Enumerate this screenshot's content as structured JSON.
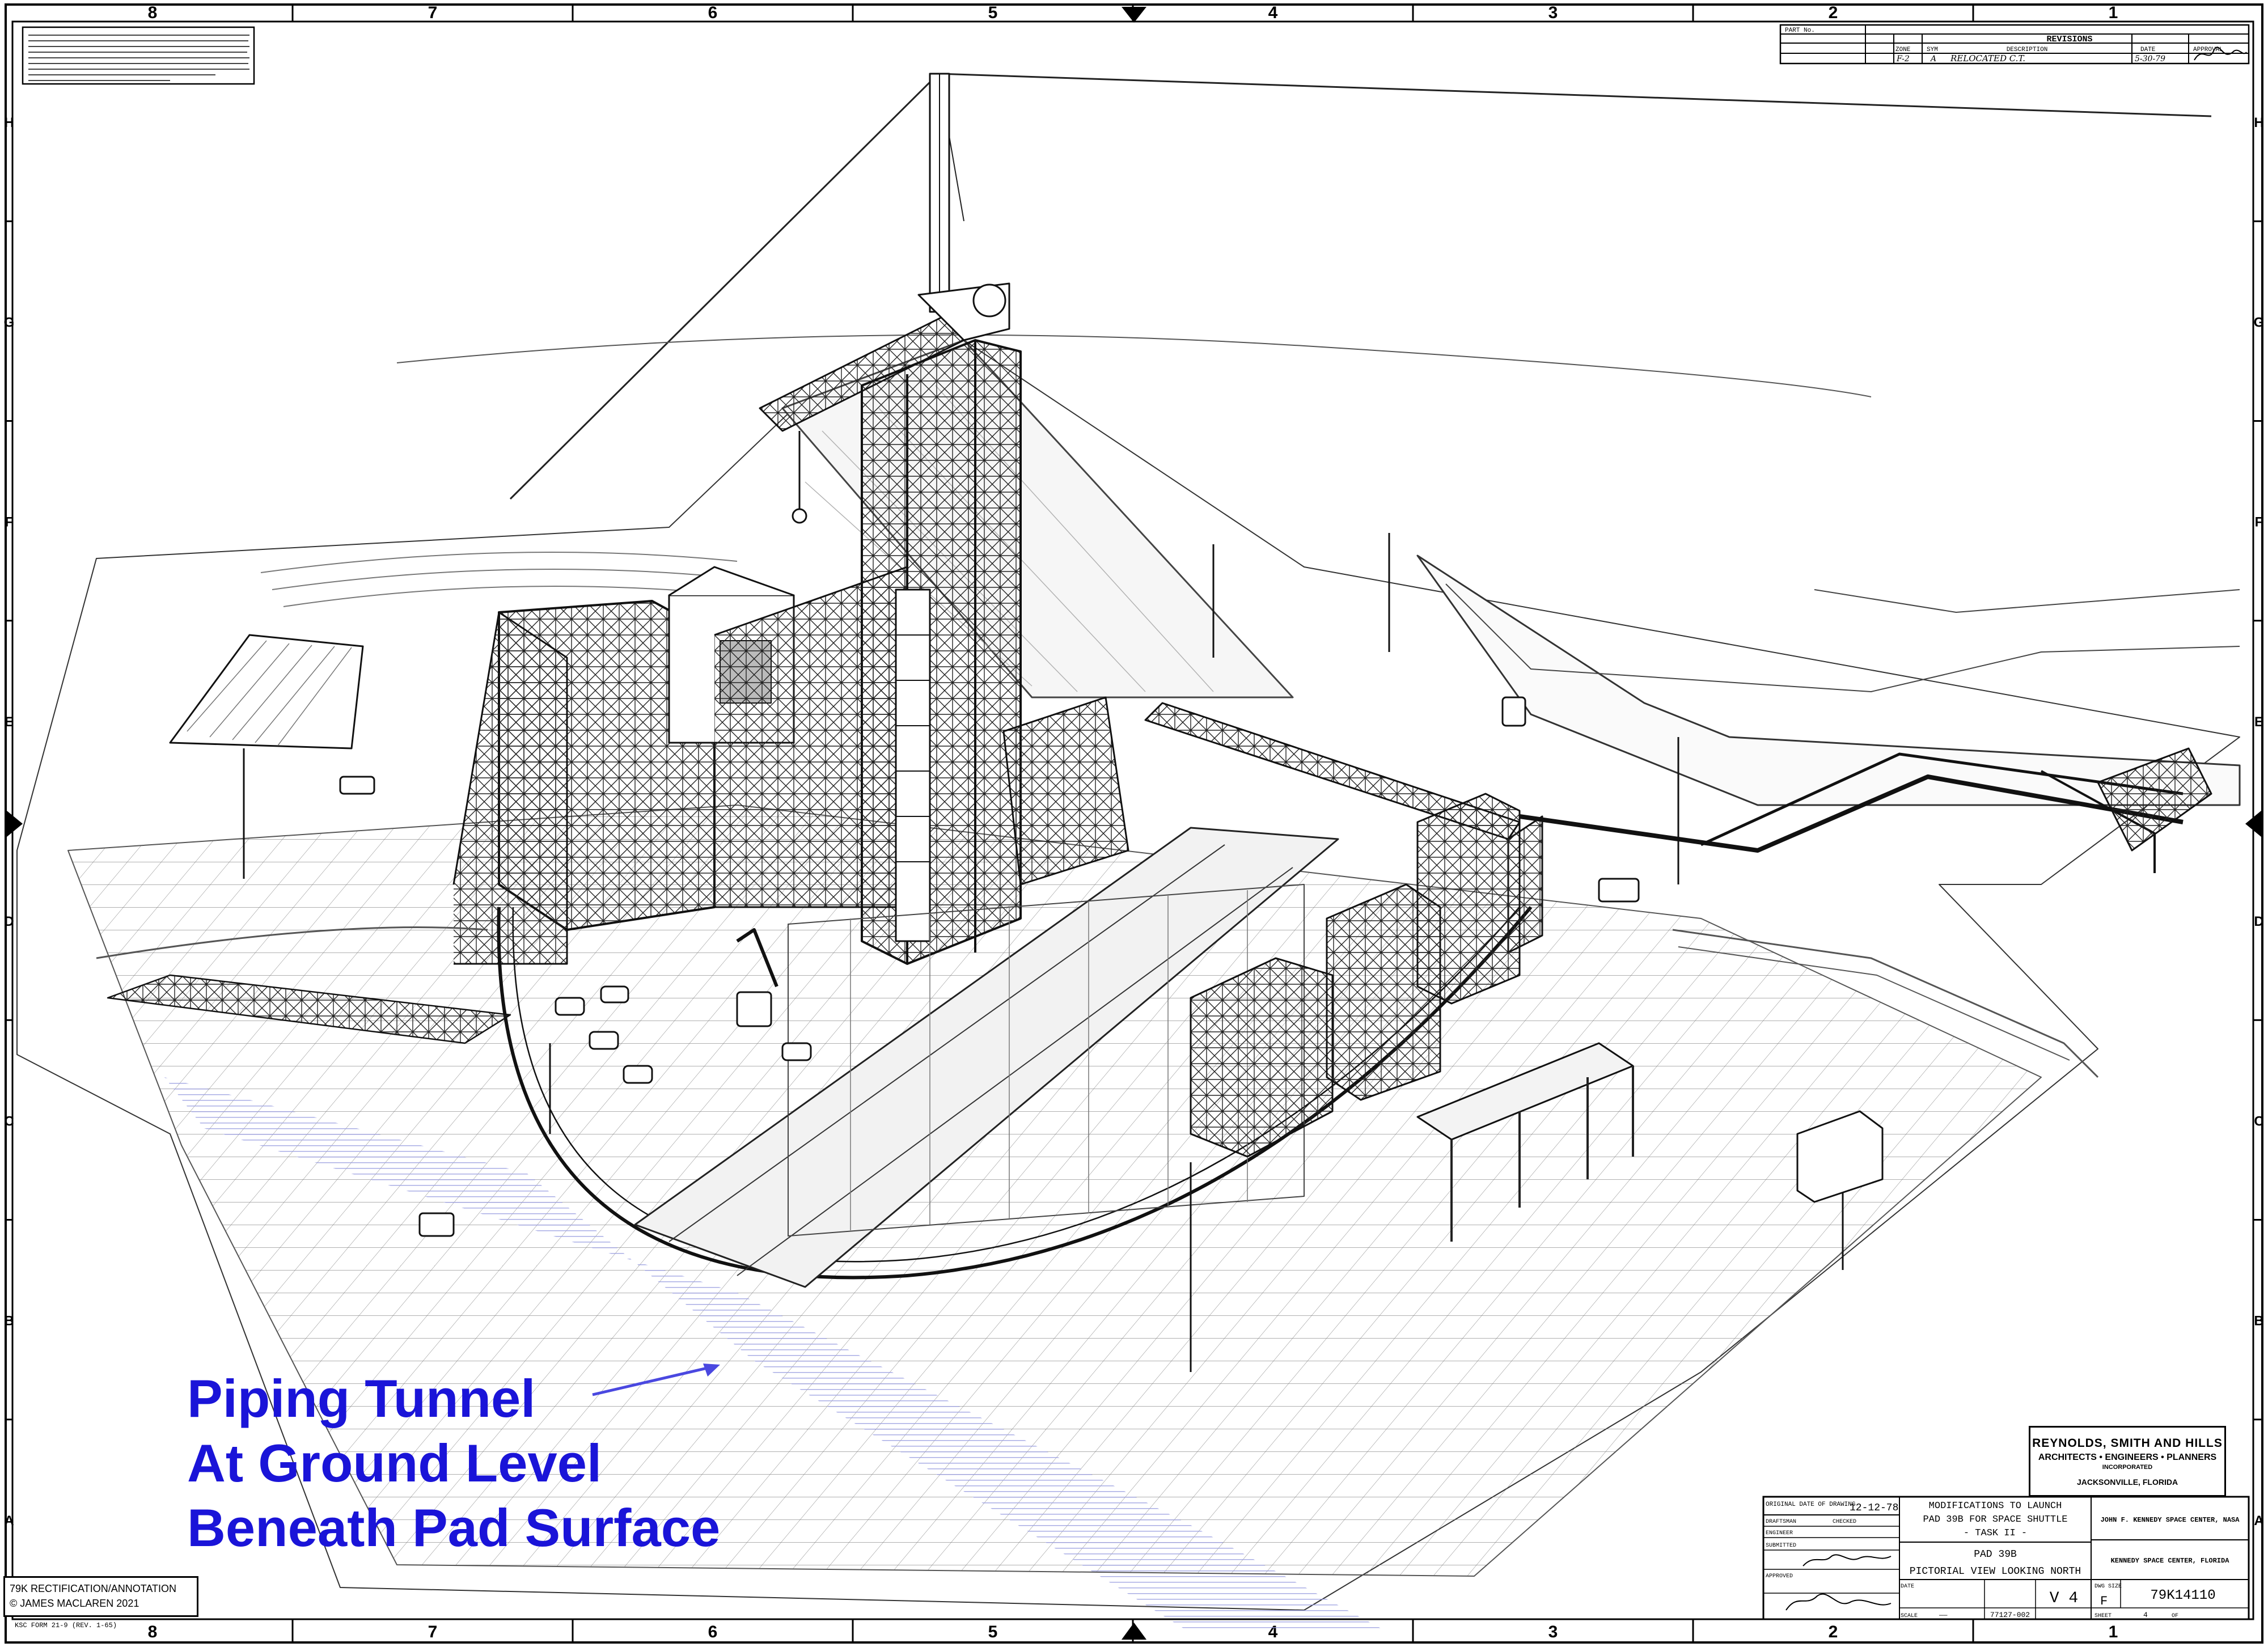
{
  "border": {
    "columns": [
      "8",
      "7",
      "6",
      "5",
      "4",
      "3",
      "2",
      "1"
    ],
    "rows": [
      "H",
      "G",
      "F",
      "E",
      "D",
      "C",
      "B",
      "A"
    ]
  },
  "annotation": {
    "lines": [
      "Piping Tunnel",
      "At Ground Level",
      "Beneath Pad Surface"
    ],
    "color": "#1a14d8"
  },
  "credit": {
    "line1": "79K RECTIFICATION/ANNOTATION",
    "line2": "© JAMES MACLAREN 2021"
  },
  "form_number": "KSC FORM 21-9 (REV. 1-65)",
  "revisions": {
    "part_no_label": "PART No.",
    "title": "REVISIONS",
    "headers": [
      "ZONE",
      "SYM",
      "DESCRIPTION",
      "DATE",
      "APPROVAL"
    ],
    "row": {
      "zone": "F-2",
      "sym": "A",
      "description": "RELOCATED C.T.",
      "date": "5-30-79"
    }
  },
  "firm": {
    "name": "REYNOLDS, SMITH AND HILLS",
    "line2": "ARCHITECTS • ENGINEERS • PLANNERS",
    "line3": "INCORPORATED",
    "city": "JACKSONVILLE, FLORIDA"
  },
  "title_block": {
    "original_date_label": "ORIGINAL DATE OF DRAWING",
    "original_date": "12-12-78",
    "draftsman_label": "DRAFTSMAN",
    "checked_label": "CHECKED",
    "engineer_label": "ENGINEER",
    "submitted_label": "SUBMITTED",
    "approved_label": "APPROVED",
    "date_label": "DATE",
    "title_1": "MODIFICATIONS TO LAUNCH",
    "title_2": "PAD 39B FOR SPACE SHUTTLE",
    "title_3": "- TASK II -",
    "pad": "PAD 39B",
    "view": "PICTORIAL VIEW LOOKING NORTH",
    "agency_1": "JOHN F. KENNEDY SPACE CENTER, NASA",
    "agency_2": "KENNEDY SPACE CENTER, FLORIDA",
    "volume": "V 4",
    "size_label": "DWG SIZE",
    "size": "F",
    "drawing_number": "79K14110",
    "scale_label": "SCALE",
    "scale": "——",
    "sheet_ref": "77127-002",
    "sheet_label": "SHEET",
    "sheet": "4",
    "of_label": "OF"
  }
}
